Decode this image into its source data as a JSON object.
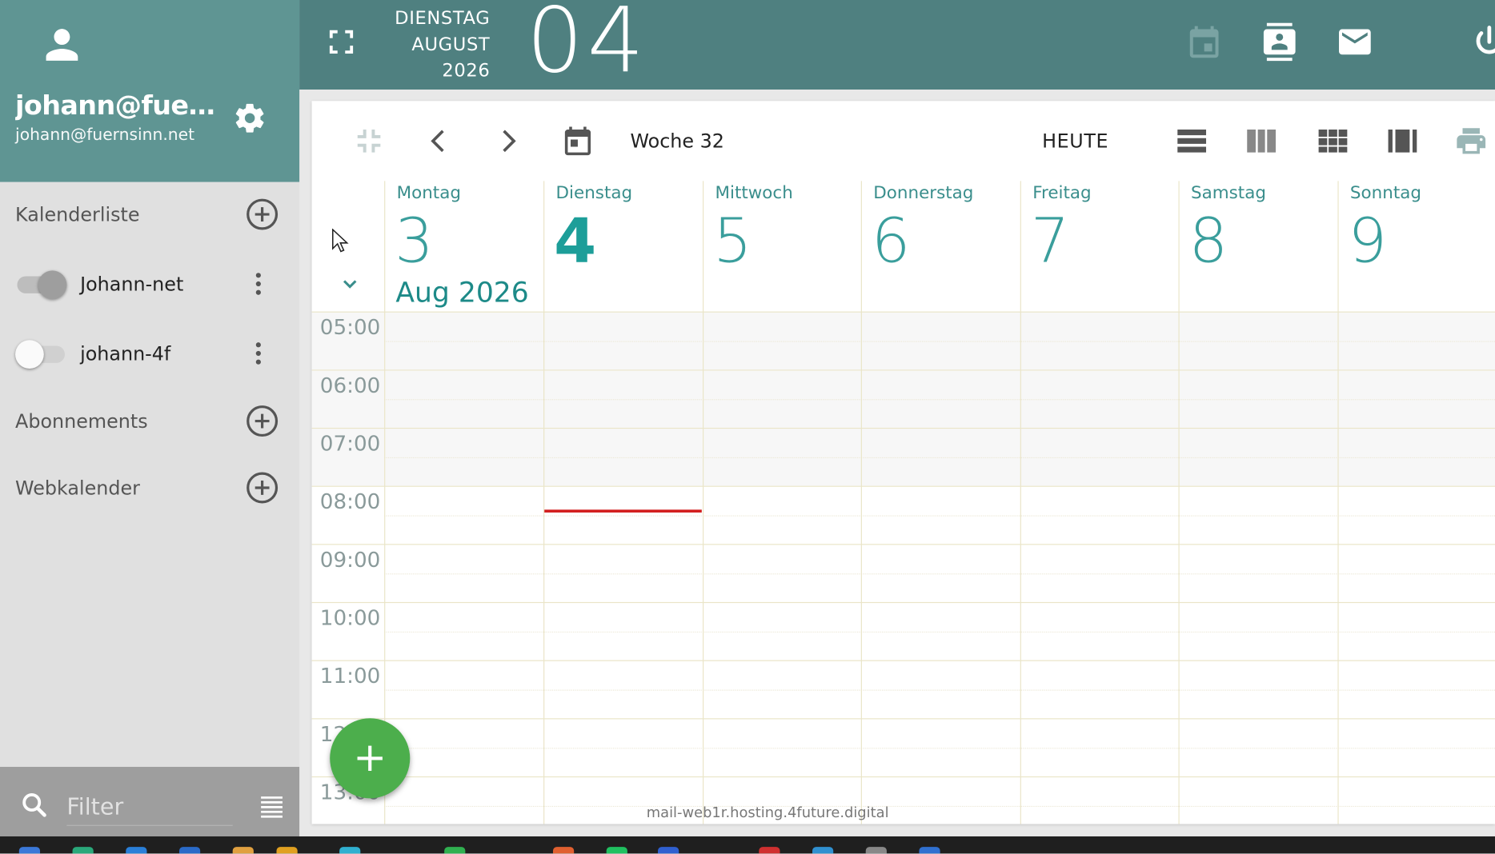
{
  "user": {
    "name": "johann@fuer...",
    "email": "johann@fuernsinn.net"
  },
  "sidebar": {
    "calendar_list_label": "Kalenderliste",
    "calendars": [
      {
        "label": "Johann-net",
        "enabled": true
      },
      {
        "label": "johann-4f",
        "enabled": false
      }
    ],
    "subscriptions_label": "Abonnements",
    "webcal_label": "Webkalender",
    "filter_placeholder": "Filter"
  },
  "topbar": {
    "weekday": "DIENSTAG",
    "month": "AUGUST",
    "year": "2026",
    "day": "04",
    "icons": [
      "calendar-icon",
      "contacts-icon",
      "mail-icon",
      "power-icon"
    ]
  },
  "toolbar": {
    "week_label": "Woche 32",
    "today_label": "HEUTE"
  },
  "week": {
    "month_label": "Aug 2026",
    "today_index": 1,
    "days": [
      {
        "name": "Montag",
        "num": "3"
      },
      {
        "name": "Dienstag",
        "num": "4"
      },
      {
        "name": "Mittwoch",
        "num": "5"
      },
      {
        "name": "Donnerstag",
        "num": "6"
      },
      {
        "name": "Freitag",
        "num": "7"
      },
      {
        "name": "Samstag",
        "num": "8"
      },
      {
        "name": "Sonntag",
        "num": "9"
      }
    ],
    "hours": [
      "05:00",
      "06:00",
      "07:00",
      "08:00",
      "09:00",
      "10:00",
      "11:00",
      "12:00",
      "13:00"
    ],
    "current_time": "08:25"
  },
  "footer": {
    "host": "mail-web1r.hosting.4future.digital"
  },
  "colors": {
    "sidebar_header": "#5f9593",
    "topbar": "#4f8080",
    "accent": "#1d9e99",
    "now_line": "#d21c1c",
    "fab": "#4cae4c"
  }
}
